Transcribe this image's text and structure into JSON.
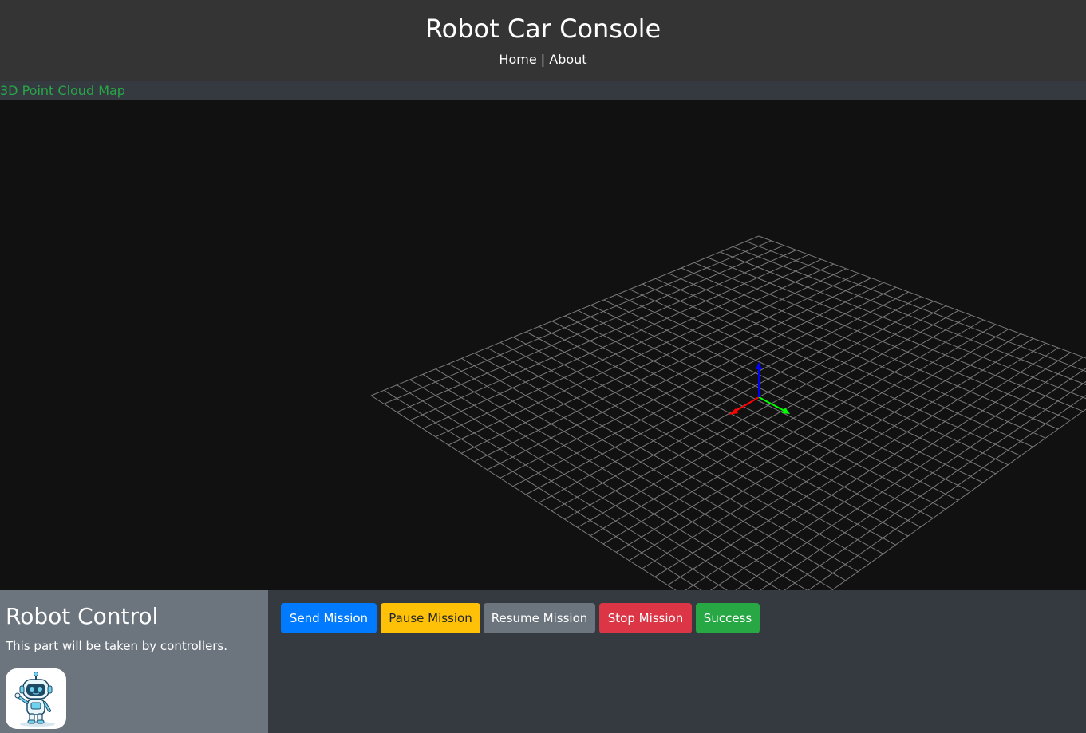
{
  "header": {
    "title": "Robot Car Console",
    "nav": {
      "home": "Home",
      "separator": "|",
      "about": "About"
    }
  },
  "map": {
    "label": "3D Point Cloud Map"
  },
  "control": {
    "title": "Robot Control",
    "description": "This part will be taken by controllers."
  },
  "actions": {
    "send": "Send Mission",
    "pause": "Pause Mission",
    "resume": "Resume Mission",
    "stop": "Stop Mission",
    "success": "Success"
  },
  "colors": {
    "header_bg": "#343434",
    "panel_bg": "#343a40",
    "viewport_bg": "#111111",
    "control_panel_bg": "#6c757d",
    "map_label": "#28a745",
    "grid": "#7a7a7a",
    "axis_x": "#ff0000",
    "axis_y": "#00ff00",
    "axis_z": "#0000ff",
    "send": "#007bff",
    "pause": "#ffc107",
    "resume": "#6c757d",
    "stop": "#dc3545",
    "success": "#28a745"
  },
  "icons": {
    "avatar": "robot-mascot-icon"
  }
}
